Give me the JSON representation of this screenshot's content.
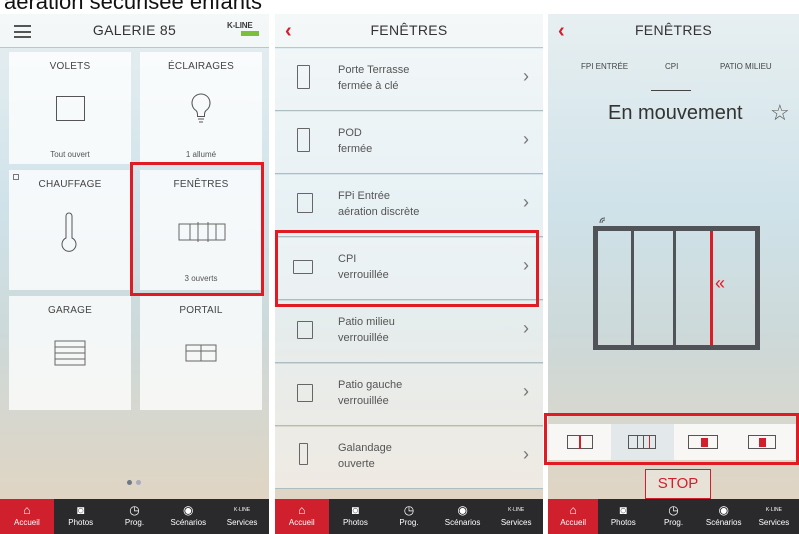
{
  "caption": "aération sécurisée enfants",
  "panel1": {
    "title": "GALERIE 85",
    "logo": "K-LINE",
    "tiles": [
      {
        "title": "VOLETS",
        "status": "Tout ouvert"
      },
      {
        "title": "ÉCLAIRAGES",
        "status": "1 allumé"
      },
      {
        "title": "CHAUFFAGE",
        "status": ""
      },
      {
        "title": "FENÊTRES",
        "status": "3 ouverts"
      },
      {
        "title": "GARAGE",
        "status": ""
      },
      {
        "title": "PORTAIL",
        "status": ""
      }
    ]
  },
  "panel2": {
    "title": "FENÊTRES",
    "items": [
      {
        "name": "Porte Terrasse",
        "state": "fermée à clé"
      },
      {
        "name": "POD",
        "state": "fermée"
      },
      {
        "name": "FPi Entrée",
        "state": "aération discrète"
      },
      {
        "name": "CPI",
        "state": "verrouillée"
      },
      {
        "name": "Patio milieu",
        "state": "verrouillée"
      },
      {
        "name": "Patio gauche",
        "state": "verrouillée"
      },
      {
        "name": "Galandage",
        "state": "ouverte"
      }
    ]
  },
  "panel3": {
    "title": "FENÊTRES",
    "subtabs": [
      "FPI ENTRÉE",
      "CPI",
      "PATIO MILIEU"
    ],
    "status": "En mouvement",
    "arrows": "«",
    "stop": "STOP"
  },
  "tabbar": [
    "Accueil",
    "Photos",
    "Prog.",
    "Scénarios",
    "Services"
  ],
  "tabbar_logo": "K·LINE",
  "colors": {
    "accent": "#d0202d",
    "highlight": "#e11b24",
    "tabbar": "#2a2a2d"
  }
}
